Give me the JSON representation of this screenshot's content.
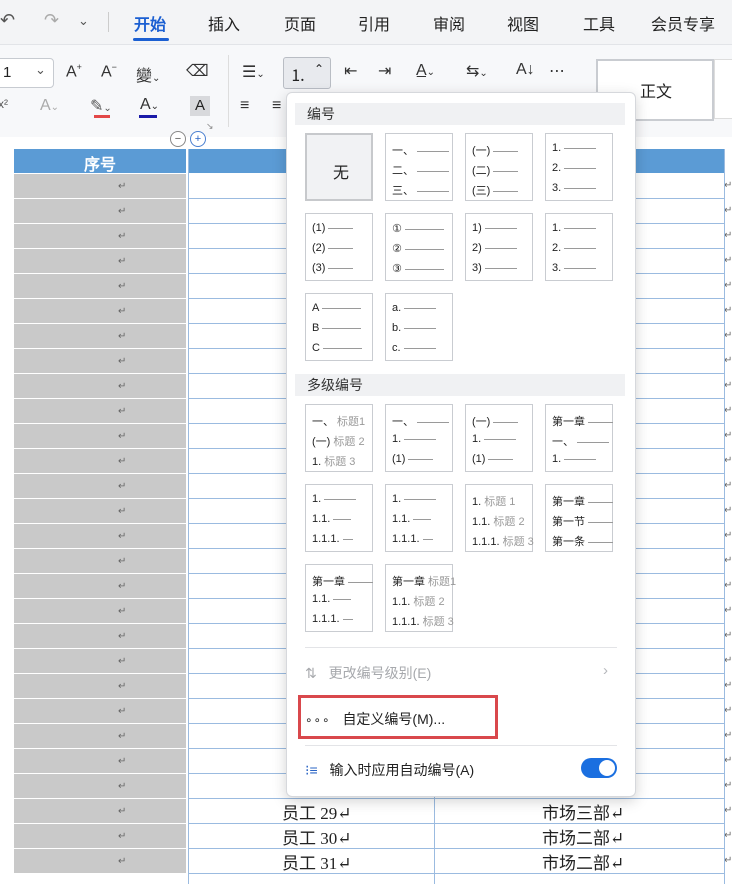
{
  "tabs": {
    "items": [
      "开始",
      "插入",
      "页面",
      "引用",
      "审阅",
      "视图",
      "工具",
      "会员专享"
    ],
    "active": "开始"
  },
  "ribbon": {
    "font_size": "1",
    "style_preview": "正文",
    "superscript_label": "x²"
  },
  "table": {
    "header_label": "序号",
    "para_mark": "↵",
    "rows": [
      {
        "name": "员工 29",
        "dept": "市场三部"
      },
      {
        "name": "员工 30",
        "dept": "市场二部"
      },
      {
        "name": "员工 31",
        "dept": "市场二部"
      }
    ]
  },
  "popup": {
    "section_numbering": "编号",
    "none_label": "无",
    "single_tiles": [
      [
        "一、",
        "二、",
        "三、"
      ],
      [
        "(一)",
        "(二)",
        "(三)"
      ],
      [
        "1.",
        "2.",
        "3."
      ],
      [
        "(1)",
        "(2)",
        "(3)"
      ],
      [
        "①",
        "②",
        "③"
      ],
      [
        "1)",
        "2)",
        "3)"
      ],
      [
        "1.",
        "2.",
        "3."
      ],
      [
        "A",
        "B",
        "C"
      ],
      [
        "a.",
        "b.",
        "c."
      ]
    ],
    "section_multilevel": "多级编号",
    "multi_tiles": [
      [
        [
          "一、",
          "标题1"
        ],
        [
          "(一)",
          "标题 2"
        ],
        [
          "1.",
          "标题 3"
        ]
      ],
      [
        [
          "一、",
          ""
        ],
        [
          "1.",
          ""
        ],
        [
          "(1)",
          ""
        ]
      ],
      [
        [
          "(一)",
          ""
        ],
        [
          "1.",
          ""
        ],
        [
          "(1)",
          ""
        ]
      ],
      [
        [
          "第一章",
          ""
        ],
        [
          "一、",
          ""
        ],
        [
          "1.",
          ""
        ]
      ],
      [
        [
          "1.",
          ""
        ],
        [
          "1.1.",
          ""
        ],
        [
          "1.1.1.",
          ""
        ]
      ],
      [
        [
          "1.",
          ""
        ],
        [
          "1.1.",
          ""
        ],
        [
          "1.1.1.",
          ""
        ]
      ],
      [
        [
          "1.",
          "标题 1"
        ],
        [
          "1.1.",
          "标题 2"
        ],
        [
          "1.1.1.",
          "标题 3"
        ]
      ],
      [
        [
          "第一章",
          ""
        ],
        [
          "第一节",
          ""
        ],
        [
          "第一条",
          ""
        ]
      ],
      [
        [
          "第一章",
          ""
        ],
        [
          "1.1.",
          ""
        ],
        [
          "1.1.1.",
          ""
        ]
      ],
      [
        [
          "第一章",
          "标题1"
        ],
        [
          "1.1.",
          "标题 2"
        ],
        [
          "1.1.1.",
          "标题 3"
        ]
      ]
    ],
    "change_level": "更改编号级别(E)",
    "custom_numbering": "自定义编号(M)...",
    "auto_numbering": "输入时应用自动编号(A)",
    "auto_numbering_on": true,
    "highlight_color": "#d9484c",
    "toggle_color": "#1b6fe0"
  }
}
